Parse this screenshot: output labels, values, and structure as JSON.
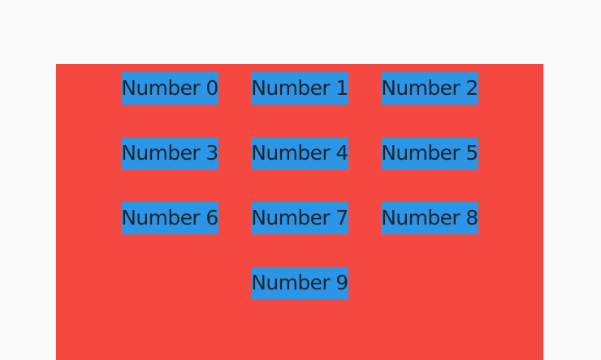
{
  "colors": {
    "background": "#fafafa",
    "panel": "#f44840",
    "tile": "#2d95e6",
    "text": "#1d2530"
  },
  "items": [
    {
      "label": "Number 0"
    },
    {
      "label": "Number 1"
    },
    {
      "label": "Number 2"
    },
    {
      "label": "Number 3"
    },
    {
      "label": "Number 4"
    },
    {
      "label": "Number 5"
    },
    {
      "label": "Number 6"
    },
    {
      "label": "Number 7"
    },
    {
      "label": "Number 8"
    },
    {
      "label": "Number 9"
    }
  ]
}
